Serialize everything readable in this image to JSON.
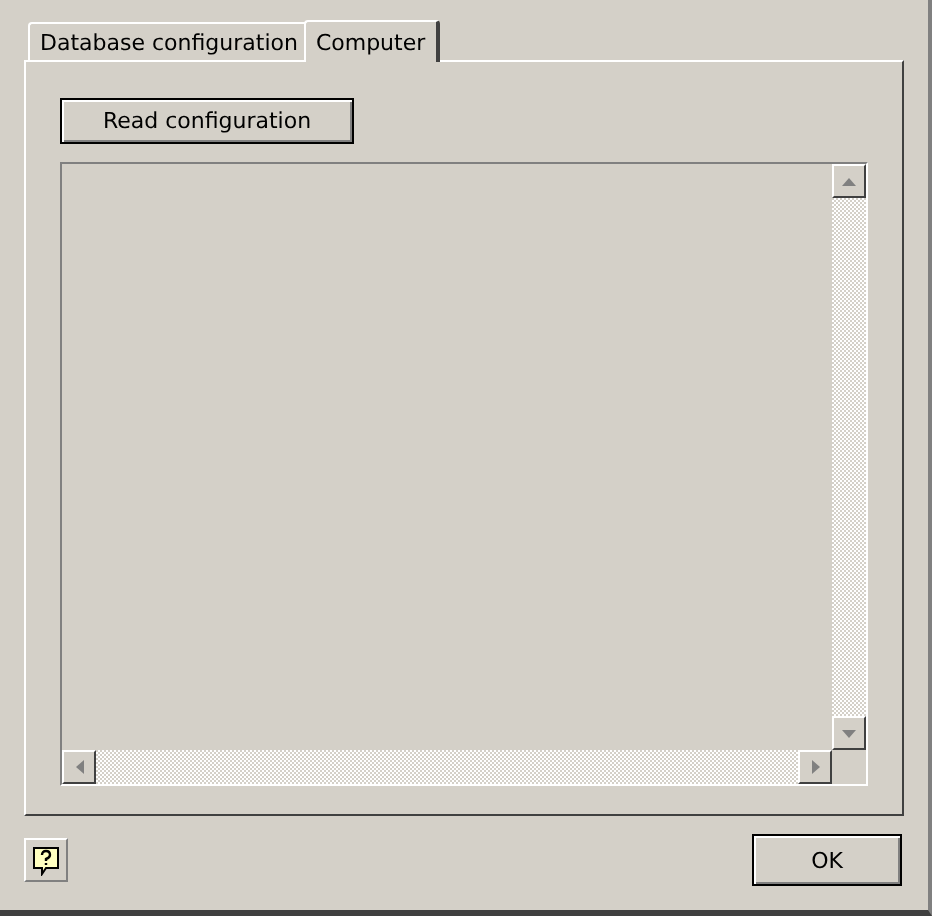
{
  "tabs": [
    {
      "label": "Database configuration",
      "selected": false
    },
    {
      "label": "Computer",
      "selected": true
    }
  ],
  "read_button": "Read configuration",
  "ok_button": "OK"
}
